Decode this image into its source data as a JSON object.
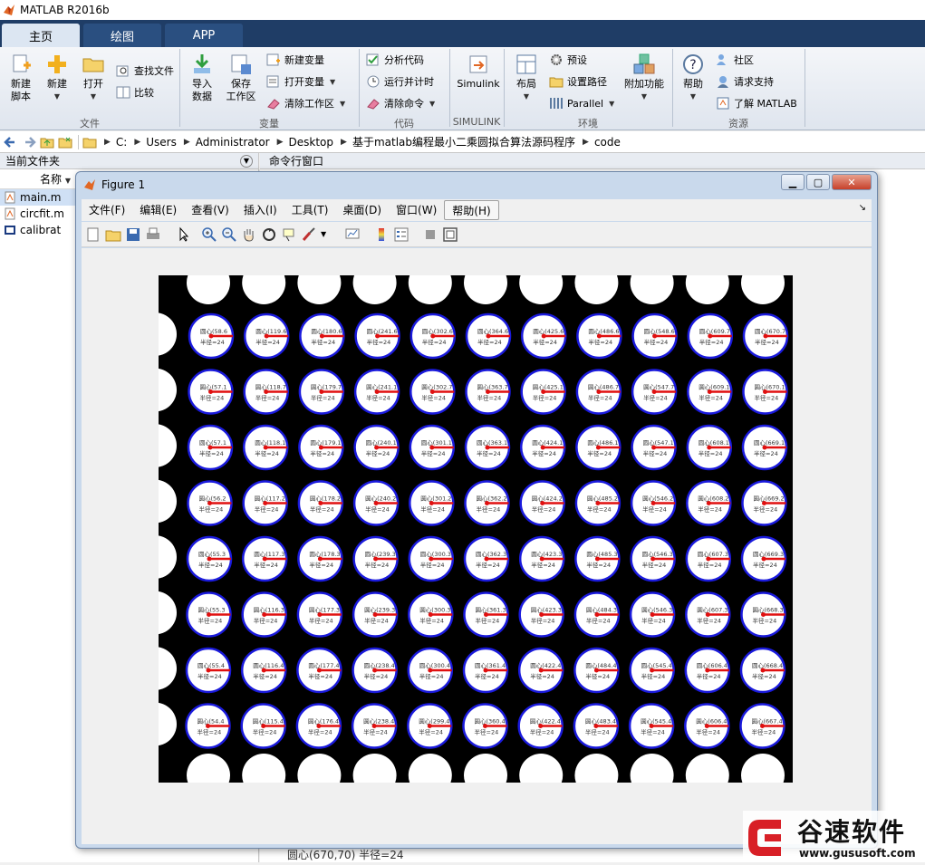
{
  "window": {
    "title": "MATLAB R2016b"
  },
  "tabs": [
    {
      "label": "主页",
      "active": true
    },
    {
      "label": "绘图",
      "active": false
    },
    {
      "label": "APP",
      "active": false
    }
  ],
  "ribbon": {
    "file": {
      "new_script": "新建\n脚本",
      "new": "新建",
      "open": "打开",
      "find_files": "查找文件",
      "compare": "比较",
      "group": "文件"
    },
    "variable": {
      "import_data": "导入\n数据",
      "save_workspace": "保存\n工作区",
      "new_variable": "新建变量",
      "open_variable": "打开变量",
      "clear_workspace": "清除工作区",
      "group": "变量"
    },
    "code": {
      "analyze": "分析代码",
      "run_time": "运行并计时",
      "clear_commands": "清除命令",
      "group": "代码"
    },
    "simulink": {
      "label": "Simulink",
      "group": "SIMULINK"
    },
    "env": {
      "layout": "布局",
      "preferences": "预设",
      "set_path": "设置路径",
      "parallel": "Parallel",
      "addons": "附加功能",
      "group": "环境"
    },
    "resources": {
      "help": "帮助",
      "community": "社区",
      "request_support": "请求支持",
      "learn": "了解 MATLAB",
      "group": "资源"
    }
  },
  "address": {
    "crumbs": [
      "C:",
      "Users",
      "Administrator",
      "Desktop",
      "基于matlab编程最小二乘圆拟合算法源码程序",
      "code"
    ]
  },
  "left_panel": {
    "title": "当前文件夹",
    "col_name": "名称",
    "files": [
      "main.m",
      "circfit.m",
      "calibrat"
    ]
  },
  "cmd_panel": {
    "title": "命令行窗口",
    "last_line": "圆心(670,70) 半径=24"
  },
  "figure": {
    "title": "Figure 1",
    "menus": [
      "文件(F)",
      "编辑(E)",
      "查看(V)",
      "插入(I)",
      "工具(T)",
      "桌面(D)",
      "窗口(W)",
      "帮助(H)"
    ],
    "grid_cols": 11,
    "grid_rows": 8,
    "label_line1": "圆心",
    "label_line2": "半径=24",
    "rows": [
      [
        "(58.6",
        "(119.6",
        "(180.6",
        "(241.6",
        "(302.6",
        "(364.6",
        "(425.6",
        "(486.6",
        "(548.6",
        "(609.7",
        "(670.7"
      ],
      [
        "(57.1",
        "(118.7",
        "(179.7",
        "(241.1",
        "(302.7",
        "(363.7",
        "(425.1",
        "(486.7",
        "(547.7",
        "(609.1",
        "(670.1"
      ],
      [
        "(57.1",
        "(118.1",
        "(179.1",
        "(240.1",
        "(301.1",
        "(363.1",
        "(424.1",
        "(486.1",
        "(547.1",
        "(608.1",
        "(669.1"
      ],
      [
        "(56.2",
        "(117.2",
        "(178.2",
        "(240.2",
        "(301.2",
        "(362.2",
        "(424.2",
        "(485.2",
        "(546.2",
        "(608.2",
        "(669.2"
      ],
      [
        "(55.3",
        "(117.3",
        "(178.3",
        "(239.3",
        "(300.3",
        "(362.3",
        "(423.3",
        "(485.3",
        "(546.3",
        "(607.3",
        "(669.3"
      ],
      [
        "(55.3",
        "(116.3",
        "(177.3",
        "(239.3",
        "(300.3",
        "(361.3",
        "(423.3",
        "(484.3",
        "(546.3",
        "(607.3",
        "(668.3"
      ],
      [
        "(55.4",
        "(116.4",
        "(177.4",
        "(238.4",
        "(300.4",
        "(361.4",
        "(422.4",
        "(484.4",
        "(545.4",
        "(606.4",
        "(668.4"
      ],
      [
        "(54.4",
        "(115.4",
        "(176.4",
        "(238.4",
        "(299.4",
        "(360.4",
        "(422.4",
        "(483.4",
        "(545.4",
        "(606.4",
        "(667.4"
      ]
    ]
  },
  "watermark": {
    "text": "谷速软件",
    "url": "www.gususoft.com"
  },
  "colors": {
    "tab_bg": "#1f3d66",
    "circle_edge": "#1a1adc",
    "radius_line": "#e01010"
  }
}
